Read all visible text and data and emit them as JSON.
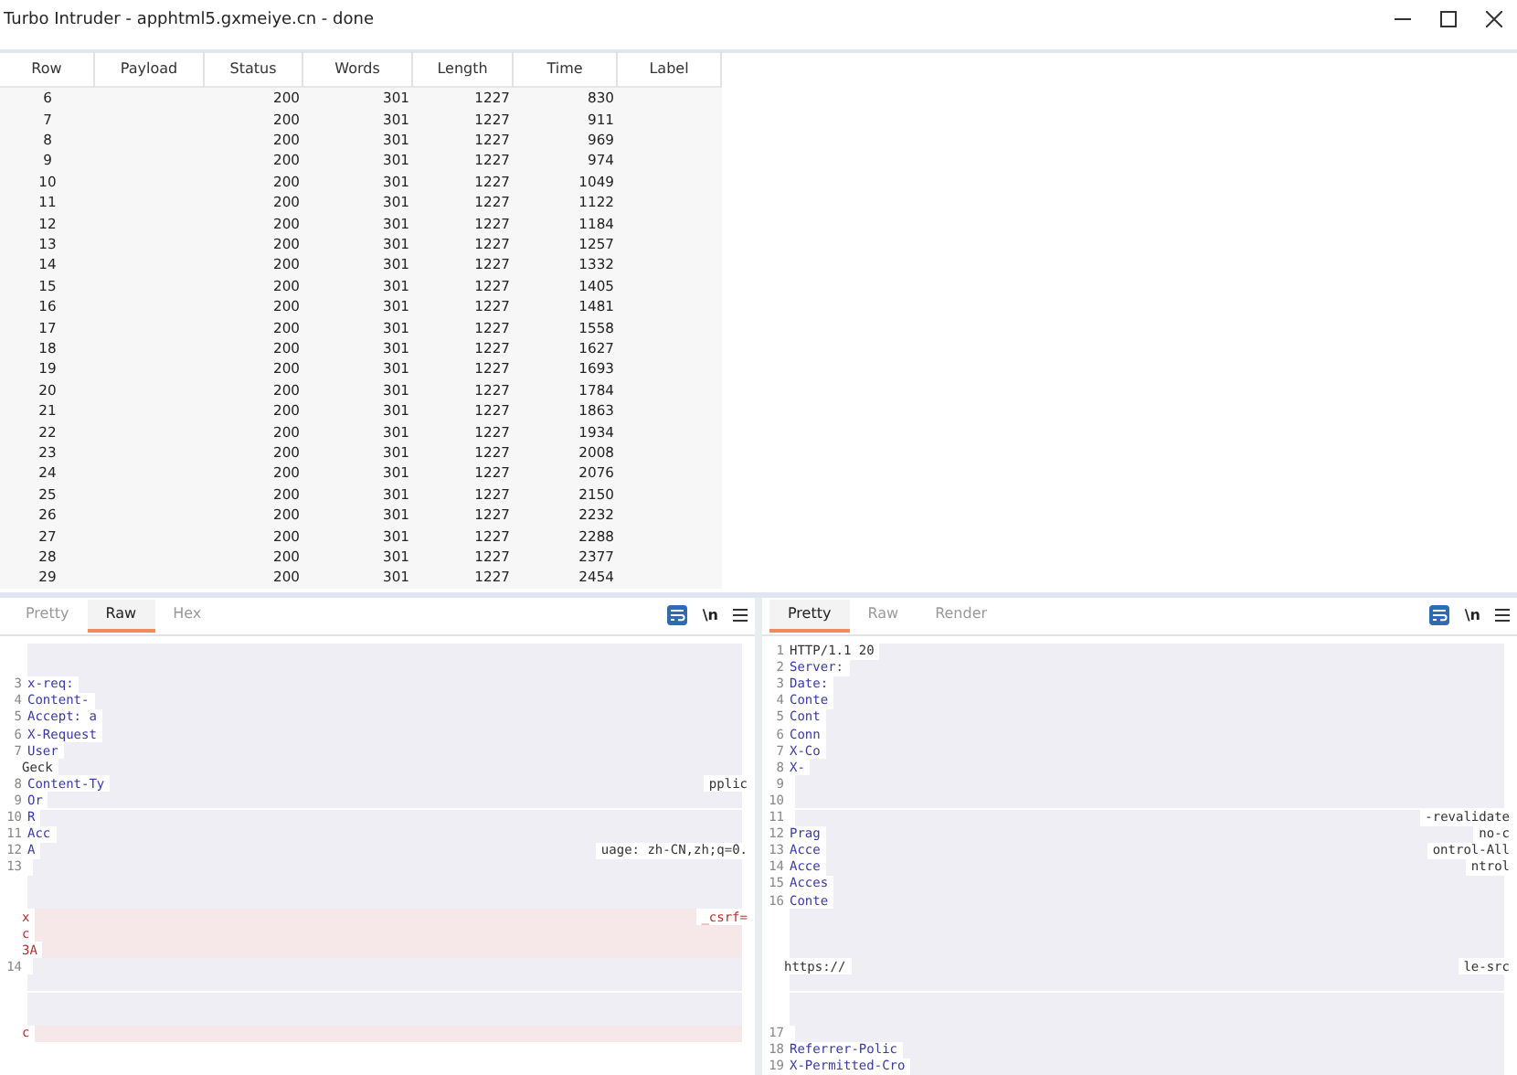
{
  "window": {
    "title": "Turbo Intruder - apphtml5.gxmeiye.cn - done"
  },
  "table": {
    "columns": [
      "Row",
      "Payload",
      "Status",
      "Words",
      "Length",
      "Time",
      "Label"
    ],
    "rows": [
      {
        "row": "6",
        "status": "200",
        "words": "301",
        "length": "1227",
        "time": "830"
      },
      {
        "row": "7",
        "status": "200",
        "words": "301",
        "length": "1227",
        "time": "911"
      },
      {
        "row": "8",
        "status": "200",
        "words": "301",
        "length": "1227",
        "time": "969"
      },
      {
        "row": "9",
        "status": "200",
        "words": "301",
        "length": "1227",
        "time": "974"
      },
      {
        "row": "10",
        "status": "200",
        "words": "301",
        "length": "1227",
        "time": "1049"
      },
      {
        "row": "11",
        "status": "200",
        "words": "301",
        "length": "1227",
        "time": "1122"
      },
      {
        "row": "12",
        "status": "200",
        "words": "301",
        "length": "1227",
        "time": "1184"
      },
      {
        "row": "13",
        "status": "200",
        "words": "301",
        "length": "1227",
        "time": "1257"
      },
      {
        "row": "14",
        "status": "200",
        "words": "301",
        "length": "1227",
        "time": "1332"
      },
      {
        "row": "15",
        "status": "200",
        "words": "301",
        "length": "1227",
        "time": "1405"
      },
      {
        "row": "16",
        "status": "200",
        "words": "301",
        "length": "1227",
        "time": "1481"
      },
      {
        "row": "17",
        "status": "200",
        "words": "301",
        "length": "1227",
        "time": "1558"
      },
      {
        "row": "18",
        "status": "200",
        "words": "301",
        "length": "1227",
        "time": "1627"
      },
      {
        "row": "19",
        "status": "200",
        "words": "301",
        "length": "1227",
        "time": "1693"
      },
      {
        "row": "20",
        "status": "200",
        "words": "301",
        "length": "1227",
        "time": "1784"
      },
      {
        "row": "21",
        "status": "200",
        "words": "301",
        "length": "1227",
        "time": "1863"
      },
      {
        "row": "22",
        "status": "200",
        "words": "301",
        "length": "1227",
        "time": "1934"
      },
      {
        "row": "23",
        "status": "200",
        "words": "301",
        "length": "1227",
        "time": "2008"
      },
      {
        "row": "24",
        "status": "200",
        "words": "301",
        "length": "1227",
        "time": "2076"
      },
      {
        "row": "25",
        "status": "200",
        "words": "301",
        "length": "1227",
        "time": "2150"
      },
      {
        "row": "26",
        "status": "200",
        "words": "301",
        "length": "1227",
        "time": "2232"
      },
      {
        "row": "27",
        "status": "200",
        "words": "301",
        "length": "1227",
        "time": "2288"
      },
      {
        "row": "28",
        "status": "200",
        "words": "301",
        "length": "1227",
        "time": "2377"
      },
      {
        "row": "29",
        "status": "200",
        "words": "301",
        "length": "1227",
        "time": "2454"
      }
    ]
  },
  "editors": [
    {
      "tabs": [
        {
          "label": "Pretty",
          "selected": false
        },
        {
          "label": "Raw",
          "selected": true
        },
        {
          "label": "Hex",
          "selected": false
        }
      ],
      "newline_toggle": "\\n",
      "lines": [
        {
          "kind": "redacted"
        },
        {
          "kind": "redacted"
        },
        {
          "number": "3",
          "text": "x-req:",
          "kind": "header"
        },
        {
          "number": "4",
          "text": "Content-",
          "kind": "header"
        },
        {
          "number": "5",
          "text": "Accept: a",
          "kind": "header"
        },
        {
          "number": "6",
          "text": "X-Request",
          "kind": "header"
        },
        {
          "number": "7",
          "text": "User",
          "kind": "header"
        },
        {
          "text": "Geck",
          "kind": "plain"
        },
        {
          "number": "8",
          "text": "Content-Ty",
          "tail": "pplic",
          "kind": "header"
        },
        {
          "number": "9",
          "text": "Or",
          "kind": "header"
        },
        {
          "number": "10",
          "text": "R",
          "kind": "header"
        },
        {
          "number": "11",
          "text": "Acc",
          "kind": "header"
        },
        {
          "number": "12",
          "text": "A",
          "tail": "uage: zh-CN,zh;q=0.",
          "kind": "header"
        },
        {
          "number": "13",
          "kind": "redacted"
        },
        {
          "kind": "redacted"
        },
        {
          "kind": "redacted"
        },
        {
          "text": "x",
          "tail": "_csrf=",
          "kind": "body"
        },
        {
          "text": "c",
          "kind": "body"
        },
        {
          "text": "3A",
          "kind": "body"
        },
        {
          "number": "14",
          "kind": "redacted"
        },
        {
          "kind": "redacted"
        },
        {
          "kind": "redacted"
        },
        {
          "kind": "redacted"
        },
        {
          "text": "c",
          "kind": "body"
        }
      ]
    },
    {
      "tabs": [
        {
          "label": "Pretty",
          "selected": true
        },
        {
          "label": "Raw",
          "selected": false
        },
        {
          "label": "Render",
          "selected": false
        }
      ],
      "newline_toggle": "\\n",
      "lines": [
        {
          "number": "1",
          "text": "HTTP/1.1 20",
          "kind": "plain"
        },
        {
          "number": "2",
          "text": "Server:",
          "kind": "header"
        },
        {
          "number": "3",
          "text": "Date:",
          "kind": "header"
        },
        {
          "number": "4",
          "text": "Conte",
          "kind": "header"
        },
        {
          "number": "5",
          "text": "Cont",
          "kind": "header"
        },
        {
          "number": "6",
          "text": "Conn",
          "kind": "header"
        },
        {
          "number": "7",
          "text": "X-Co",
          "kind": "header"
        },
        {
          "number": "8",
          "text": "X-",
          "kind": "header"
        },
        {
          "number": "9",
          "kind": "redacted"
        },
        {
          "number": "10",
          "kind": "redacted"
        },
        {
          "number": "11",
          "tail": "-revalidate",
          "kind": "header"
        },
        {
          "number": "12",
          "text": "Prag",
          "tail": "no-c",
          "kind": "header"
        },
        {
          "number": "13",
          "text": "Acce",
          "tail": "ontrol-All",
          "kind": "header"
        },
        {
          "number": "14",
          "text": "Acce",
          "tail": "ntrol",
          "kind": "header"
        },
        {
          "number": "15",
          "text": "Acces",
          "kind": "header"
        },
        {
          "number": "16",
          "text": "Conte",
          "kind": "header"
        },
        {
          "kind": "redacted"
        },
        {
          "kind": "redacted"
        },
        {
          "kind": "redacted"
        },
        {
          "text": "https://",
          "tail": "le-src",
          "kind": "plain"
        },
        {
          "kind": "redacted"
        },
        {
          "kind": "redacted"
        },
        {
          "kind": "redacted"
        },
        {
          "number": "17",
          "kind": "redacted"
        },
        {
          "number": "18",
          "text": "Referrer-Polic",
          "kind": "header"
        },
        {
          "number": "19",
          "text": "X-Permitted-Cro",
          "kind": "header"
        }
      ]
    }
  ]
}
